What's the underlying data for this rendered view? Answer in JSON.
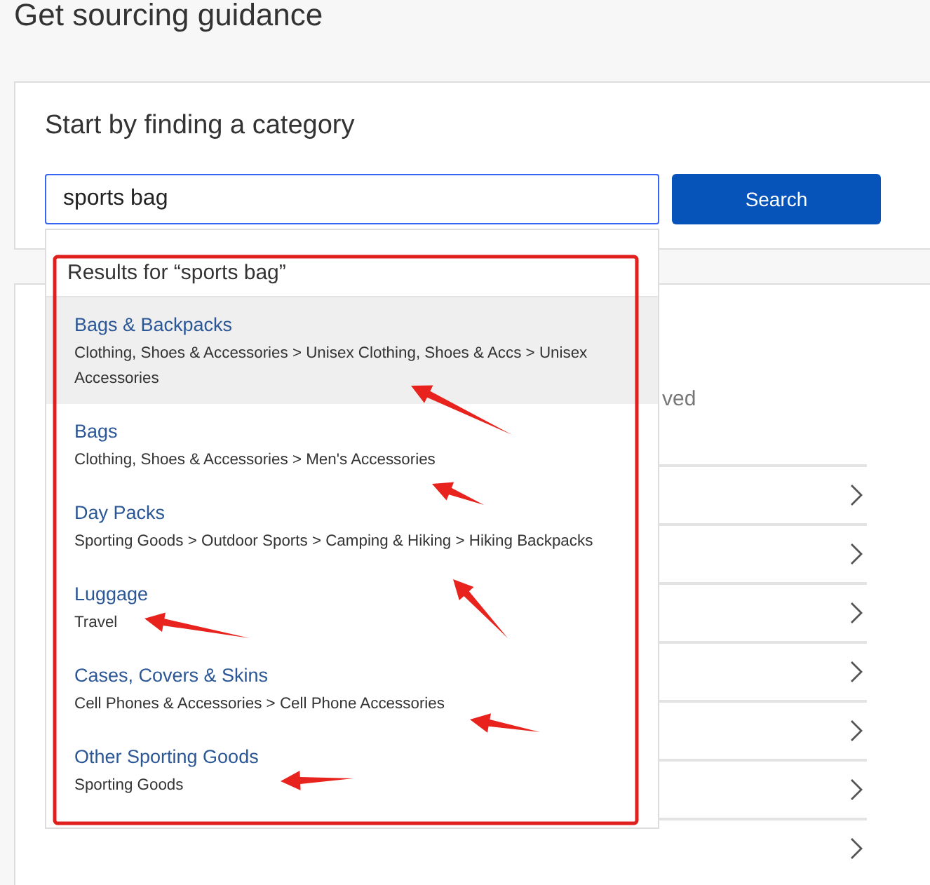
{
  "page_title": "Get sourcing guidance",
  "category_search": {
    "heading": "Start by finding a category",
    "value": "sports bag",
    "button": "Search"
  },
  "behind_text": "ved",
  "results": {
    "header": "Results for “sports bag”",
    "items": [
      {
        "title": "Bags & Backpacks",
        "path": "Clothing, Shoes & Accessories > Unisex Clothing, Shoes & Accs > Unisex Accessories",
        "selected": true
      },
      {
        "title": "Bags",
        "path": "Clothing, Shoes & Accessories > Men's Accessories",
        "selected": false
      },
      {
        "title": "Day Packs",
        "path": "Sporting Goods > Outdoor Sports > Camping & Hiking > Hiking Backpacks",
        "selected": false
      },
      {
        "title": "Luggage",
        "path": "Travel",
        "selected": false
      },
      {
        "title": "Cases, Covers & Skins",
        "path": "Cell Phones & Accessories > Cell Phone Accessories",
        "selected": false
      },
      {
        "title": "Other Sporting Goods",
        "path": "Sporting Goods",
        "selected": false
      }
    ]
  }
}
